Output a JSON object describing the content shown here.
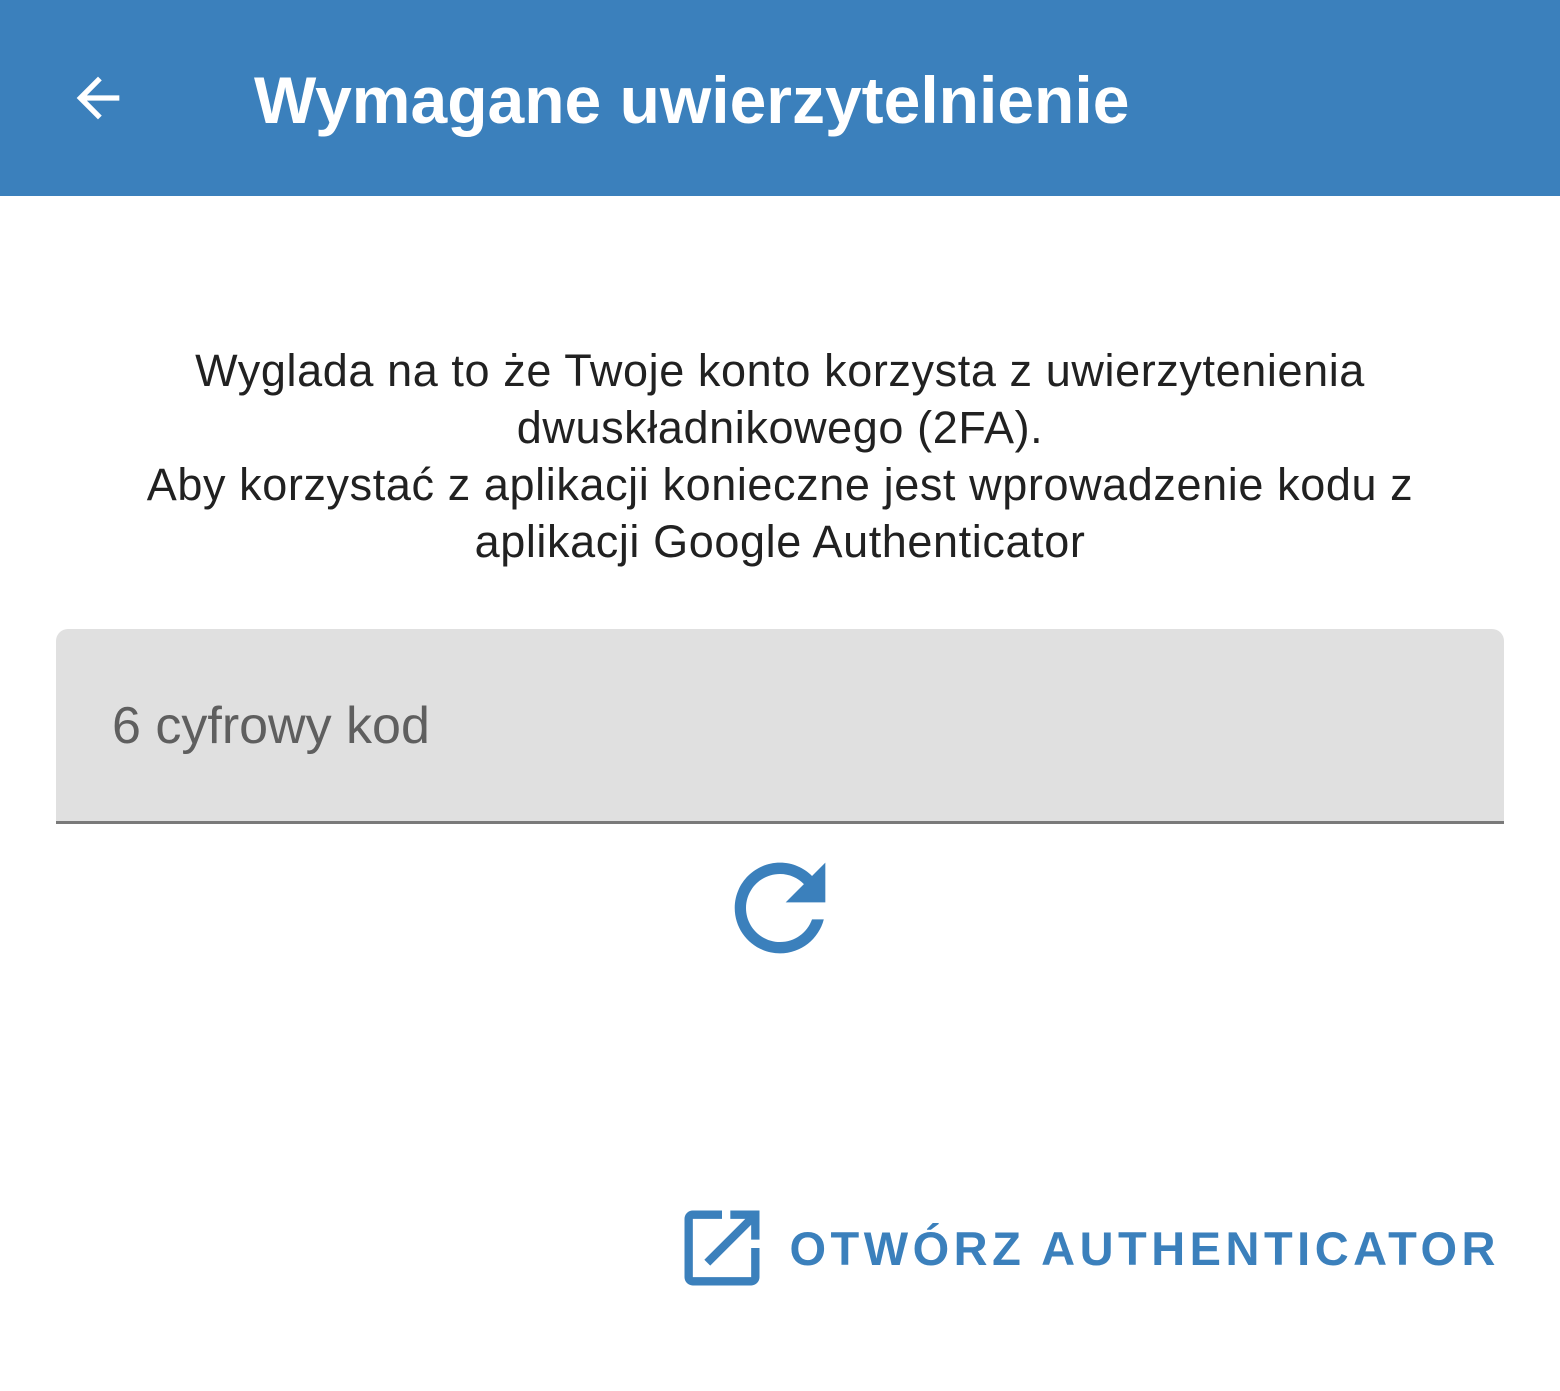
{
  "colors": {
    "primary": "#3b80bc",
    "field_background": "#e0e0e0",
    "on_primary": "#ffffff"
  },
  "appbar": {
    "back_icon": "arrow-back-icon",
    "title": "Wymagane uwierzytelnienie"
  },
  "message": {
    "line1": "Wyglada na to że Twoje konto korzysta z uwierzytenienia",
    "line2": "dwuskładnikowego (2FA).",
    "line3": "Aby korzystać z aplikacji konieczne jest wprowadzenie kodu z",
    "line4": "aplikacji Google Authenticator"
  },
  "code_field": {
    "value": "",
    "placeholder": "6 cyfrowy kod"
  },
  "refresh": {
    "icon": "refresh-icon"
  },
  "open_authenticator": {
    "icon": "open-in-new-icon",
    "label": "OTWÓRZ AUTHENTICATOR"
  }
}
